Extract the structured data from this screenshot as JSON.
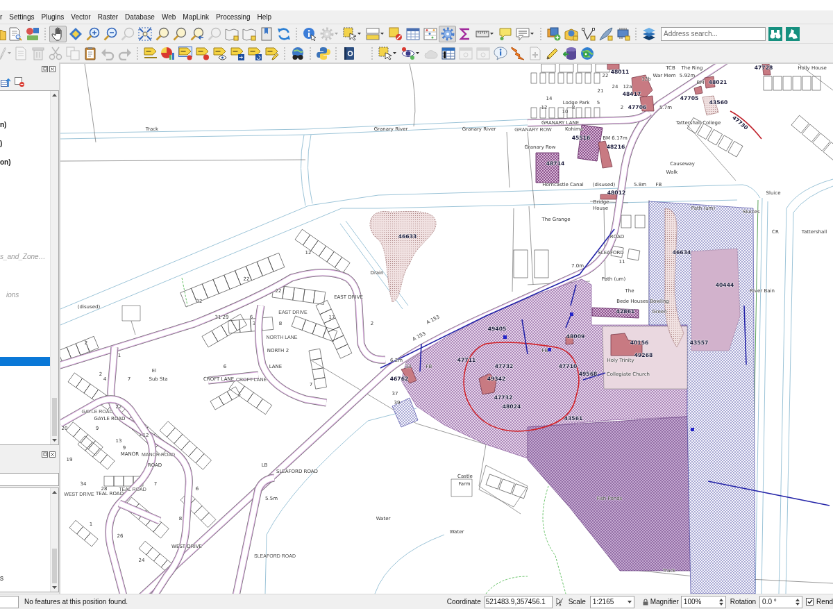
{
  "menu_bar": [
    "r",
    "Settings",
    "Plugins",
    "Vector",
    "Raster",
    "Database",
    "Web",
    "MapLink",
    "Processing",
    "Help"
  ],
  "toolbars": [
    {
      "groups": [
        [
          {
            "disabled": false,
            "pressed": false,
            "menu": false
          },
          {
            "disabled": false,
            "pressed": false,
            "menu": false
          },
          {
            "disabled": false,
            "pressed": false,
            "menu": false
          }
        ],
        [
          {
            "disabled": false,
            "pressed": true,
            "menu": false
          },
          {
            "disabled": false,
            "pressed": false,
            "menu": false
          },
          {
            "disabled": false,
            "pressed": false,
            "menu": false
          },
          {
            "disabled": false,
            "pressed": false,
            "menu": false
          },
          {
            "disabled": true,
            "pressed": false,
            "menu": false
          },
          {
            "disabled": false,
            "pressed": false,
            "menu": false
          },
          {
            "disabled": false,
            "pressed": false,
            "menu": false
          },
          {
            "disabled": false,
            "pressed": false,
            "menu": false
          },
          {
            "disabled": false,
            "pressed": false,
            "menu": false
          },
          {
            "disabled": true,
            "pressed": false,
            "menu": false
          },
          {
            "disabled": false,
            "pressed": false,
            "menu": false
          },
          {
            "disabled": false,
            "pressed": false,
            "menu": false
          },
          {
            "disabled": false,
            "pressed": false,
            "menu": false
          },
          {
            "disabled": false,
            "pressed": false,
            "menu": false
          }
        ],
        [
          {
            "disabled": false,
            "pressed": false,
            "menu": false
          },
          {
            "disabled": true,
            "pressed": false,
            "menu": true
          },
          {
            "disabled": false,
            "pressed": false,
            "menu": true
          },
          {
            "disabled": false,
            "pressed": false,
            "menu": true
          },
          {
            "disabled": false,
            "pressed": false,
            "menu": false
          },
          {
            "disabled": false,
            "pressed": false,
            "menu": false
          },
          {
            "disabled": false,
            "pressed": false,
            "menu": false
          },
          {
            "disabled": false,
            "pressed": true,
            "menu": false
          },
          {
            "disabled": false,
            "pressed": false,
            "menu": false
          },
          {
            "disabled": false,
            "pressed": false,
            "menu": true
          },
          {
            "disabled": false,
            "pressed": false,
            "menu": false
          },
          {
            "disabled": false,
            "pressed": false,
            "menu": true
          }
        ],
        [
          {
            "disabled": false,
            "pressed": false,
            "menu": false
          },
          {
            "disabled": false,
            "pressed": false,
            "menu": false
          },
          {
            "disabled": false,
            "pressed": false,
            "menu": false
          },
          {
            "disabled": false,
            "pressed": false,
            "menu": false
          },
          {
            "disabled": false,
            "pressed": false,
            "menu": false
          }
        ],
        [
          {
            "disabled": false,
            "pressed": false,
            "menu": false
          }
        ]
      ],
      "address_search": {
        "placeholder": "Address search..."
      },
      "search_buttons": [
        {
          "disabled": false,
          "pressed": false,
          "menu": false
        },
        {
          "disabled": false,
          "pressed": false,
          "menu": false
        }
      ]
    },
    {
      "groups": [
        [
          {
            "disabled": true,
            "pressed": false,
            "menu": true
          },
          {
            "disabled": true,
            "pressed": false,
            "menu": false
          },
          {
            "disabled": true,
            "pressed": false,
            "menu": false
          },
          {
            "disabled": true,
            "pressed": false,
            "menu": false
          },
          {
            "disabled": true,
            "pressed": false,
            "menu": false
          },
          {
            "disabled": false,
            "pressed": false,
            "menu": false
          },
          {
            "disabled": true,
            "pressed": false,
            "menu": false
          },
          {
            "disabled": true,
            "pressed": false,
            "menu": false
          }
        ],
        [
          {
            "disabled": false,
            "pressed": false,
            "menu": false
          },
          {
            "disabled": false,
            "pressed": false,
            "menu": false
          },
          {
            "disabled": false,
            "pressed": false,
            "menu": false
          },
          {
            "disabled": false,
            "pressed": false,
            "menu": false
          },
          {
            "disabled": false,
            "pressed": false,
            "menu": false
          },
          {
            "disabled": false,
            "pressed": false,
            "menu": false
          },
          {
            "disabled": false,
            "pressed": false,
            "menu": false
          },
          {
            "disabled": false,
            "pressed": false,
            "menu": false
          }
        ],
        [
          {
            "disabled": false,
            "pressed": false,
            "menu": false
          }
        ],
        [
          {
            "disabled": false,
            "pressed": false,
            "menu": false
          }
        ],
        [
          {
            "disabled": false,
            "pressed": false,
            "menu": false
          }
        ],
        [
          {
            "disabled": false,
            "pressed": false,
            "menu": true
          },
          {
            "disabled": false,
            "pressed": false,
            "menu": true
          },
          {
            "disabled": true,
            "pressed": false,
            "menu": false
          },
          {
            "disabled": false,
            "pressed": false,
            "menu": false
          },
          {
            "disabled": true,
            "pressed": false,
            "menu": false
          },
          {
            "disabled": true,
            "pressed": false,
            "menu": false
          },
          {
            "disabled": false,
            "pressed": false,
            "menu": false
          },
          {
            "disabled": false,
            "pressed": false,
            "menu": false
          },
          {
            "disabled": true,
            "pressed": false,
            "menu": false
          },
          {
            "disabled": false,
            "pressed": false,
            "menu": false
          },
          {
            "disabled": false,
            "pressed": false,
            "menu": false
          },
          {
            "disabled": false,
            "pressed": false,
            "menu": false
          }
        ]
      ]
    }
  ],
  "layers_panel": {
    "items": [
      {
        "label": "n)",
        "kind": "group",
        "disabled": false,
        "selected": false
      },
      {
        "label": ")",
        "kind": "group",
        "disabled": false,
        "selected": false
      },
      {
        "label": "on)",
        "kind": "group",
        "disabled": false,
        "selected": false
      },
      {
        "label": "s_and_Zone…",
        "kind": "layer",
        "disabled": true,
        "selected": false
      },
      {
        "label": "ions",
        "kind": "layer",
        "disabled": true,
        "selected": false
      },
      {
        "kind": "layer",
        "disabled": false,
        "selected": true
      }
    ]
  },
  "browser_panel": {
    "items": [
      "s"
    ]
  },
  "map": {
    "labels": [
      {
        "text": "TCB",
        "kind": "name"
      },
      {
        "text": "The Ring",
        "kind": "name"
      },
      {
        "text": "47728",
        "kind": "parcel"
      },
      {
        "text": "Holly House",
        "kind": "name"
      },
      {
        "text": "48011",
        "kind": "parcel"
      },
      {
        "text": "22",
        "kind": "number"
      },
      {
        "text": "War Mem",
        "kind": "name"
      },
      {
        "text": "5.92m",
        "kind": "name"
      },
      {
        "text": "12b",
        "kind": "number"
      },
      {
        "text": "BM",
        "kind": "name"
      },
      {
        "text": "48021",
        "kind": "parcel"
      },
      {
        "text": "24",
        "kind": "number"
      },
      {
        "text": "12a",
        "kind": "number"
      },
      {
        "text": "21",
        "kind": "number"
      },
      {
        "text": "48417",
        "kind": "parcel"
      },
      {
        "text": "14",
        "kind": "number"
      },
      {
        "text": "47705",
        "kind": "parcel"
      },
      {
        "text": "Lodge Park",
        "kind": "name"
      },
      {
        "text": "5",
        "kind": "number"
      },
      {
        "text": "43560",
        "kind": "parcel"
      },
      {
        "text": "12",
        "kind": "number"
      },
      {
        "text": "8",
        "kind": "number"
      },
      {
        "text": "2",
        "kind": "number"
      },
      {
        "text": "47706",
        "kind": "parcel"
      },
      {
        "text": "5.7m",
        "kind": "name"
      },
      {
        "text": "10",
        "kind": "number"
      },
      {
        "text": "GRANARY LANE",
        "kind": "name"
      },
      {
        "text": "Tattershall College",
        "kind": "name"
      },
      {
        "text": "Track",
        "kind": "name"
      },
      {
        "text": "Granary River",
        "kind": "name"
      },
      {
        "text": "Granary River",
        "kind": "name"
      },
      {
        "text": "GRANARY ROW",
        "kind": "small"
      },
      {
        "text": "Kohima",
        "kind": "name"
      },
      {
        "text": "47730",
        "kind": "parcel"
      },
      {
        "text": "45516",
        "kind": "parcel"
      },
      {
        "text": "BM 6.17m",
        "kind": "name"
      },
      {
        "text": "Granary Row",
        "kind": "name"
      },
      {
        "text": "48216",
        "kind": "parcel"
      },
      {
        "text": "48714",
        "kind": "parcel"
      },
      {
        "text": "Causeway",
        "kind": "name"
      },
      {
        "text": "Walk",
        "kind": "name"
      },
      {
        "text": "Horncastle Canal",
        "kind": "name"
      },
      {
        "text": "(disused)",
        "kind": "name"
      },
      {
        "text": "5.8m",
        "kind": "name"
      },
      {
        "text": "FB",
        "kind": "name"
      },
      {
        "text": "48012",
        "kind": "parcel"
      },
      {
        "text": "Sluice",
        "kind": "name"
      },
      {
        "text": "Bridge",
        "kind": "name"
      },
      {
        "text": "House",
        "kind": "name"
      },
      {
        "text": "Path (um)",
        "kind": "name"
      },
      {
        "text": "Sluices",
        "kind": "name"
      },
      {
        "text": "The Grange",
        "kind": "name"
      },
      {
        "text": "CR",
        "kind": "name"
      },
      {
        "text": "Tattershall",
        "kind": "name"
      },
      {
        "text": "46633",
        "kind": "parcel"
      },
      {
        "text": "ROAD",
        "kind": "name"
      },
      {
        "text": "12",
        "kind": "number"
      },
      {
        "text": "SLEAFORD",
        "kind": "name"
      },
      {
        "text": "46634",
        "kind": "parcel"
      },
      {
        "text": "11",
        "kind": "number"
      },
      {
        "text": "7.0m",
        "kind": "name"
      },
      {
        "text": "Drain",
        "kind": "name"
      },
      {
        "text": "22",
        "kind": "number"
      },
      {
        "text": "Path (um)",
        "kind": "name"
      },
      {
        "text": "40444",
        "kind": "parcel"
      },
      {
        "text": "22",
        "kind": "number"
      },
      {
        "text": "The",
        "kind": "name"
      },
      {
        "text": "River Bain",
        "kind": "name"
      },
      {
        "text": "EAST DRIVE",
        "kind": "name"
      },
      {
        "text": "32",
        "kind": "number"
      },
      {
        "text": "Bede Houses",
        "kind": "name"
      },
      {
        "text": "Bowling",
        "kind": "name"
      },
      {
        "text": "(disused)",
        "kind": "name"
      },
      {
        "text": "EAST DRIVE",
        "kind": "small"
      },
      {
        "text": "42861",
        "kind": "parcel"
      },
      {
        "text": "Green",
        "kind": "name"
      },
      {
        "text": "31",
        "kind": "number"
      },
      {
        "text": "29",
        "kind": "number"
      },
      {
        "text": "6",
        "kind": "number"
      },
      {
        "text": "17",
        "kind": "number"
      },
      {
        "text": "3",
        "kind": "number"
      },
      {
        "text": "8",
        "kind": "number"
      },
      {
        "text": "2",
        "kind": "number"
      },
      {
        "text": "A 153",
        "kind": "name"
      },
      {
        "text": "49405",
        "kind": "parcel"
      },
      {
        "text": "NORTH LANE",
        "kind": "small"
      },
      {
        "text": "A 153",
        "kind": "name"
      },
      {
        "text": "48009",
        "kind": "parcel"
      },
      {
        "text": "2",
        "kind": "number"
      },
      {
        "text": "40156",
        "kind": "parcel"
      },
      {
        "text": "43557",
        "kind": "parcel"
      },
      {
        "text": "NORTH",
        "kind": "name"
      },
      {
        "text": "2",
        "kind": "number"
      },
      {
        "text": "FB",
        "kind": "name"
      },
      {
        "text": "1",
        "kind": "number"
      },
      {
        "text": "49268",
        "kind": "parcel"
      },
      {
        "text": "6.2m",
        "kind": "name"
      },
      {
        "text": "47711",
        "kind": "parcel"
      },
      {
        "text": "Holy Trinity",
        "kind": "name"
      },
      {
        "text": "6",
        "kind": "number"
      },
      {
        "text": "LANE",
        "kind": "name"
      },
      {
        "text": "33",
        "kind": "number"
      },
      {
        "text": "FB",
        "kind": "name"
      },
      {
        "text": "47732",
        "kind": "parcel"
      },
      {
        "text": "47710",
        "kind": "parcel"
      },
      {
        "text": "El",
        "kind": "name"
      },
      {
        "text": "2",
        "kind": "number"
      },
      {
        "text": "49568",
        "kind": "parcel"
      },
      {
        "text": "Collegiate Church",
        "kind": "name"
      },
      {
        "text": "4",
        "kind": "number"
      },
      {
        "text": "7",
        "kind": "number"
      },
      {
        "text": "Sub Sta",
        "kind": "name"
      },
      {
        "text": "CROFT LANE",
        "kind": "name"
      },
      {
        "text": "CROFT LANE",
        "kind": "small"
      },
      {
        "text": "46762",
        "kind": "parcel"
      },
      {
        "text": "49342",
        "kind": "parcel"
      },
      {
        "text": "7",
        "kind": "number"
      },
      {
        "text": "37",
        "kind": "number"
      },
      {
        "text": "47732",
        "kind": "parcel"
      },
      {
        "text": "39",
        "kind": "number"
      },
      {
        "text": "22",
        "kind": "number"
      },
      {
        "text": "48024",
        "kind": "parcel"
      },
      {
        "text": "GAYLE ROAD",
        "kind": "small"
      },
      {
        "text": "GAYLE ROAD",
        "kind": "name"
      },
      {
        "text": "43561",
        "kind": "parcel"
      },
      {
        "text": "20",
        "kind": "number"
      },
      {
        "text": "9",
        "kind": "number"
      },
      {
        "text": "12",
        "kind": "number"
      },
      {
        "text": "13",
        "kind": "number"
      },
      {
        "text": "9",
        "kind": "number"
      },
      {
        "text": "MANOR",
        "kind": "name"
      },
      {
        "text": "MANOR ROAD",
        "kind": "small"
      },
      {
        "text": "19",
        "kind": "number"
      },
      {
        "text": "ROAD",
        "kind": "name"
      },
      {
        "text": "LB",
        "kind": "name"
      },
      {
        "text": "SLEAFORD ROAD",
        "kind": "name"
      },
      {
        "text": "Castle",
        "kind": "name"
      },
      {
        "text": "34",
        "kind": "number"
      },
      {
        "text": "7",
        "kind": "number"
      },
      {
        "text": "Farm",
        "kind": "name"
      },
      {
        "text": "28",
        "kind": "number"
      },
      {
        "text": "TEAL ROAD",
        "kind": "small"
      },
      {
        "text": "6",
        "kind": "number"
      },
      {
        "text": "WEST DRIVE",
        "kind": "small"
      },
      {
        "text": "TEAL ROAD",
        "kind": "name"
      },
      {
        "text": "5.5m",
        "kind": "name"
      },
      {
        "text": "Fish Ponds",
        "kind": "name"
      },
      {
        "text": "8",
        "kind": "number"
      },
      {
        "text": "Water",
        "kind": "name"
      },
      {
        "text": "1",
        "kind": "number"
      },
      {
        "text": "Water",
        "kind": "name"
      },
      {
        "text": "26",
        "kind": "number"
      },
      {
        "text": "WEST DRIVE",
        "kind": "name"
      },
      {
        "text": "SLEAFORD ROAD",
        "kind": "small"
      },
      {
        "text": "24",
        "kind": "number"
      },
      {
        "text": "Track",
        "kind": "name"
      }
    ]
  },
  "status_bar": {
    "message": "No features at this position found.",
    "coordinate_label": "Coordinate",
    "coordinate": "521483.9,357456.1",
    "scale_label": "Scale",
    "scale": "1:2165",
    "magnifier_label": "Magnifier",
    "magnifier": "100%",
    "rotation_label": "Rotation",
    "rotation": "0.0 °",
    "render": {
      "label": "Rend",
      "checked": true
    }
  }
}
